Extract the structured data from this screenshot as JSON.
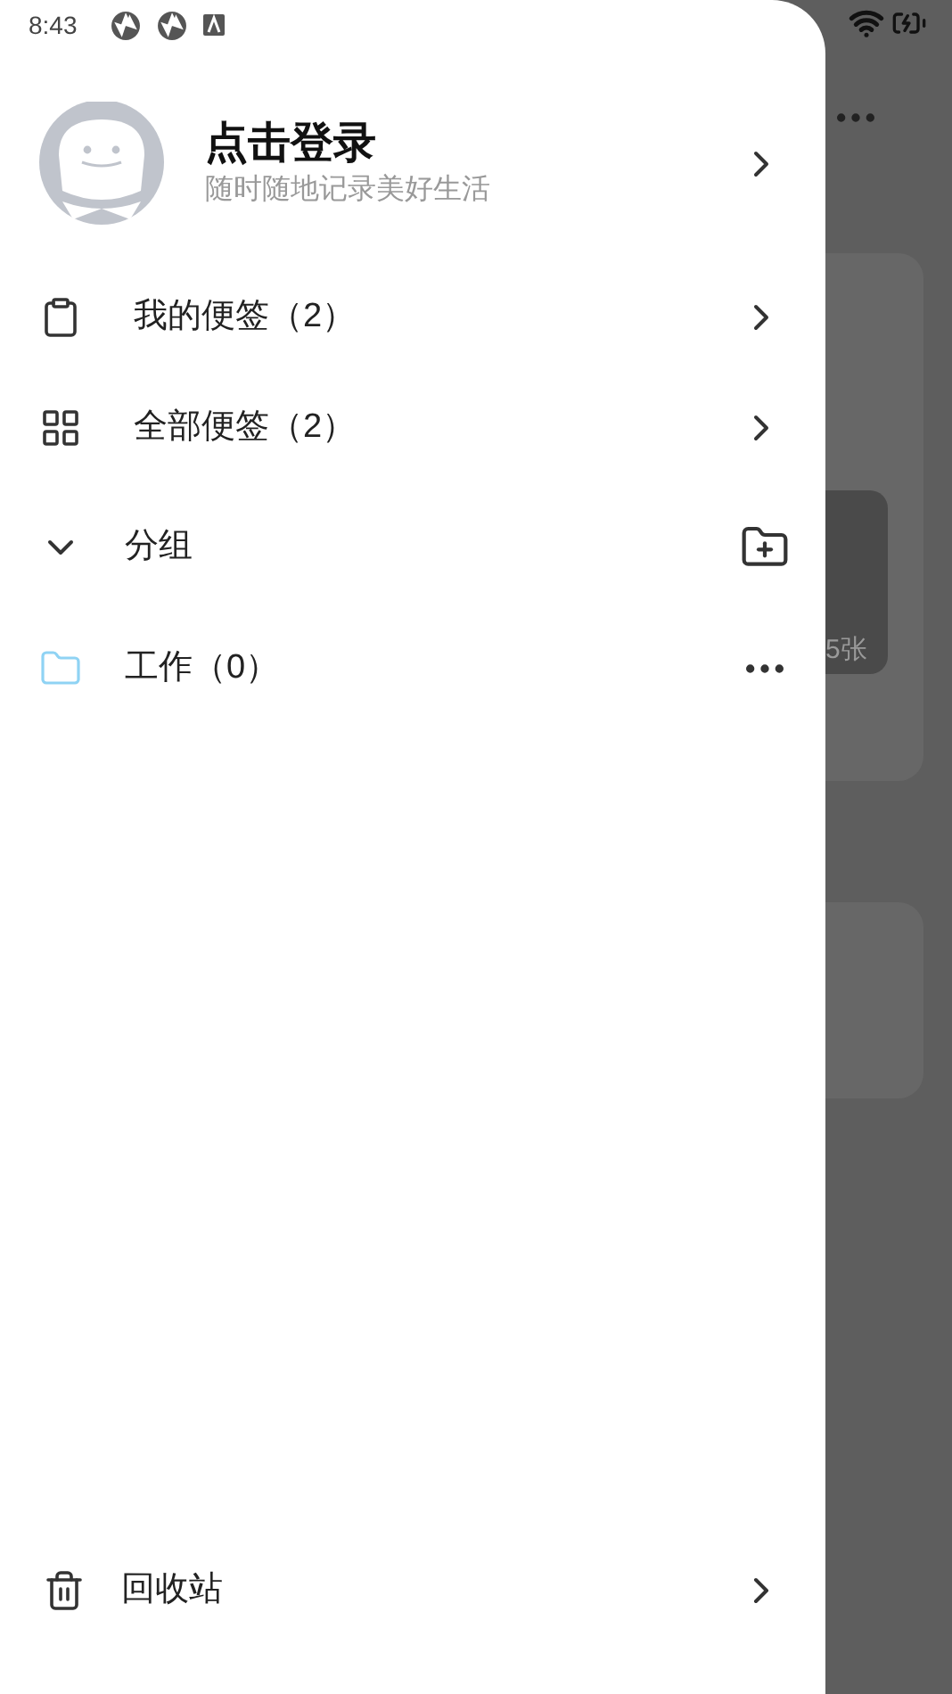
{
  "status_bar": {
    "time": "8:43"
  },
  "profile": {
    "title": "点击登录",
    "subtitle": "随时随地记录美好生活"
  },
  "nav_items": [
    {
      "label": "我的便签（2）",
      "kind": "clipboard"
    },
    {
      "label": "全部便签（2）",
      "kind": "grid"
    }
  ],
  "groups": {
    "label": "分组",
    "expanded": true,
    "items": [
      {
        "label": "工作（0）"
      }
    ]
  },
  "trash": {
    "label": "回收站"
  },
  "background": {
    "badge": "5张"
  }
}
